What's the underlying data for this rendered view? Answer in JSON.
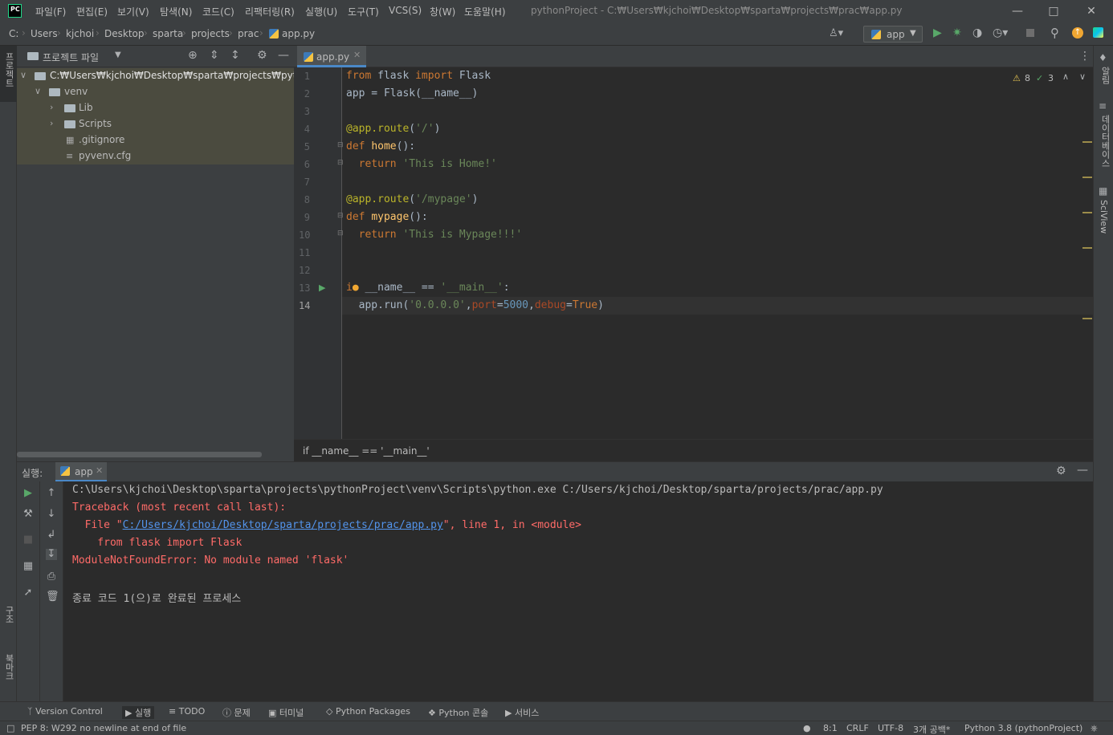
{
  "menu": {
    "items": [
      "파일(F)",
      "편집(E)",
      "보기(V)",
      "탐색(N)",
      "코드(C)",
      "리팩터링(R)",
      "실행(U)",
      "도구(T)",
      "VCS(S)",
      "창(W)",
      "도움말(H)"
    ],
    "window_title": "pythonProject - C:₩Users₩kjchoi₩Desktop₩sparta₩projects₩prac₩app.py",
    "logo": "PC"
  },
  "navbar": {
    "crumbs": [
      "C:",
      "Users",
      "kjchoi",
      "Desktop",
      "sparta",
      "projects",
      "prac",
      "app.py"
    ],
    "run_config": "app"
  },
  "side_labels": {
    "left_top": "프로젝트",
    "left_structure": "구조",
    "left_bookmarks": "북마크",
    "right_notify": "알림",
    "right_db": "데이터베이스",
    "right_sciview": "SciView"
  },
  "project": {
    "header": "프로젝트 파일",
    "root": "C:₩Users₩kjchoi₩Desktop₩sparta₩projects₩python",
    "items": [
      {
        "label": "venv"
      },
      {
        "label": "Lib"
      },
      {
        "label": "Scripts"
      },
      {
        "label": ".gitignore"
      },
      {
        "label": "pyvenv.cfg"
      }
    ]
  },
  "editor": {
    "tab": "app.py",
    "warnings": "8",
    "checks": "3",
    "line_numbers": [
      "1",
      "2",
      "3",
      "4",
      "5",
      "6",
      "7",
      "8",
      "9",
      "10",
      "11",
      "12",
      "13",
      "14"
    ],
    "breadcrumb": "if __name__ == '__main__'"
  },
  "run": {
    "label": "실행:",
    "tab": "app",
    "lines": {
      "cmd": "C:\\Users\\kjchoi\\Desktop\\sparta\\projects\\pythonProject\\venv\\Scripts\\python.exe C:/Users/kjchoi/Desktop/sparta/projects/prac/app.py",
      "traceback": "Traceback (most recent call last):",
      "file_prefix": "  File \"",
      "file_link": "C:/Users/kjchoi/Desktop/sparta/projects/prac/app.py",
      "file_suffix": "\", line 1, in <module>",
      "code": "    from flask import Flask",
      "error": "ModuleNotFoundError: No module named 'flask'",
      "exit": "종료 코드 1(으)로 완료된 프로세스"
    }
  },
  "bottom_tabs": [
    "Version Control",
    "실행",
    "TODO",
    "문제",
    "터미널",
    "Python Packages",
    "Python 콘솔",
    "서비스"
  ],
  "status": {
    "message": "PEP 8: W292 no newline at end of file",
    "position": "8:1",
    "line_sep": "CRLF",
    "encoding": "UTF-8",
    "indent": "3개 공백*",
    "interpreter": "Python 3.8 (pythonProject)"
  },
  "colors": {
    "accent": "#4a88c7",
    "error": "#ff6b68",
    "run_green": "#59a869"
  }
}
